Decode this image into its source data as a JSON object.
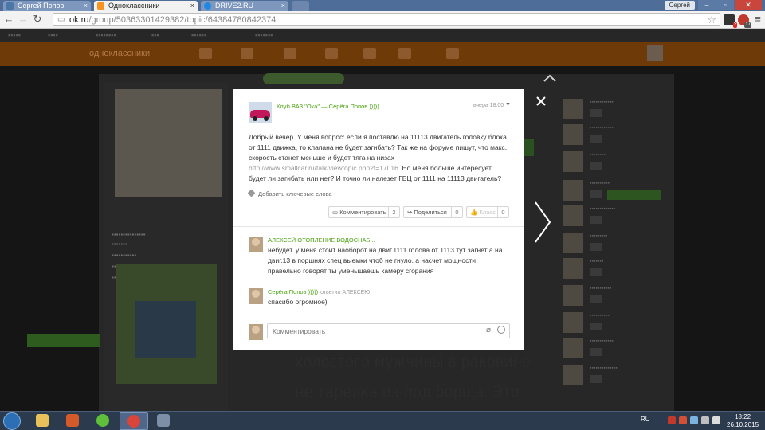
{
  "browser": {
    "tabs": [
      {
        "title": "Сергей Попов",
        "icon": "vk-icon",
        "color": "#4a76a8"
      },
      {
        "title": "Одноклассники",
        "icon": "ok-icon",
        "color": "#f7931e"
      },
      {
        "title": "DRIVE2.RU",
        "icon": "drive2-icon",
        "color": "#1e88e5"
      }
    ],
    "window_user": "Сергей",
    "url_host": "ok.ru",
    "url_path": "/group/50363301429382/topic/64384780842374",
    "extension_badge": "3",
    "extension_badge_abp": "17"
  },
  "background": {
    "logo": "одноклассники",
    "text_line_1": "холостого мужчины в раковине",
    "text_line_2": "не тарелка из-под борща. Это"
  },
  "topic": {
    "author": "Клуб ВАЗ \"Ока\" — Серёга Попов )))))",
    "time": "вчера 18:00",
    "body_line_1": "Добрый вечер. У меня вопрос: если я поставлю на 11113 двигатель головку блока",
    "body_line_2": "от 1111 движка, то клапана не будет загибать? Так же на форуме пишут, что макс.",
    "body_line_3": "скорость станет меньше и будет тяга на низах",
    "body_link": "http://www.smallcar.ru/talk/viewtopic.php?t=17016",
    "body_line_4_after_link": ". Но меня больше интересует",
    "body_line_5": "будет ли загибать или нет? И точно ли налезет ГБЦ от 1111 на 11113 двигатель?",
    "tags_label": "Добавить ключевые слова",
    "actions": {
      "comment_label": "Комментировать",
      "comment_count": "2",
      "share_label": "Поделиться",
      "share_count": "0",
      "like_label": "Класс",
      "like_count": "0"
    }
  },
  "comments": [
    {
      "author": "АЛЕКСЕЙ ОТОПЛЕНИЕ ВОДОСНАБ...",
      "meta": "",
      "lines": [
        "небудет. у меня стоит наоборот на двиг.1111 голова от 1113 тут загнет а на",
        "двиг.13 в поршнях спец выемки чтоб не гнуло. а насчет мощности",
        "правельно говорят ты уменьшаешь камеру сгорания"
      ]
    },
    {
      "author": "Серёга Попов )))))",
      "meta": "ответил АЛЕКСЕЮ",
      "lines": [
        "спасибо огромное)"
      ]
    }
  ],
  "comment_input": {
    "placeholder": "Комментировать"
  },
  "taskbar": {
    "language": "RU",
    "time": "18:22",
    "date": "26.10.2015"
  },
  "colors": {
    "link_green": "#4aa30f",
    "ok_orange": "#f7931e"
  }
}
